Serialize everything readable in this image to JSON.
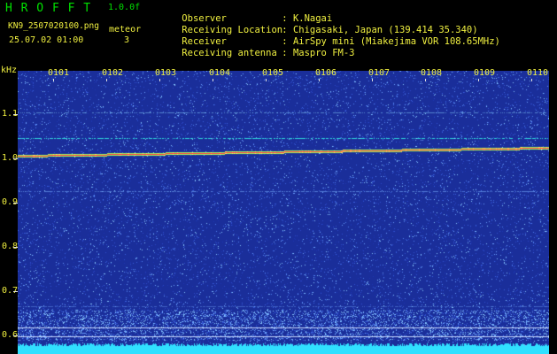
{
  "header": {
    "title": "H R O F F T",
    "version": "1.0.0f",
    "filename": "KN9_2507020100.png",
    "datetime": "25.07.02 01:00",
    "meteor_label": "meteor",
    "meteor_count": "3"
  },
  "info": [
    {
      "label": "Observer",
      "value": "K.Nagai"
    },
    {
      "label": "Receiving Location",
      "value": "Chigasaki, Japan (139.414 35.340)"
    },
    {
      "label": "Receiver",
      "value": "AirSpy mini (Miakejima VOR 108.65MHz)"
    },
    {
      "label": "Receiving antenna",
      "value": "Maspro FM-3"
    }
  ],
  "axis": {
    "unit": "kHz",
    "y_ticks": [
      "1.1",
      "1.0",
      "0.9",
      "0.8",
      "0.7",
      "0.6"
    ],
    "time_labels": [
      "0101",
      "0102",
      "0103",
      "0104",
      "0105",
      "0106",
      "0107",
      "0108",
      "0109",
      "0110"
    ]
  },
  "colors": {
    "background": "#000000",
    "header_green": "#00e000",
    "header_yellow": "#f0f040",
    "plot_blue": "#1a2e9a",
    "trace_red": "#ff3040",
    "baseline_cyan": "#30e0ff"
  }
}
